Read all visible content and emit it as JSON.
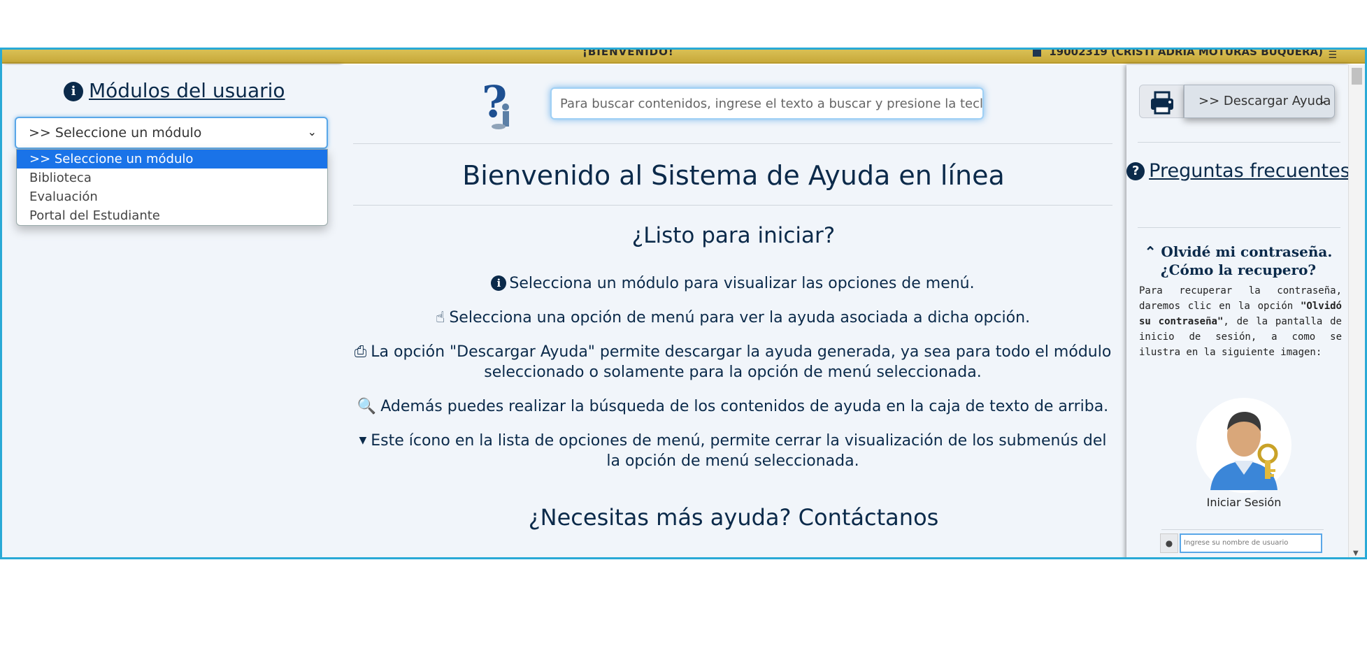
{
  "header": {
    "welcome": "¡BIENVENIDO!",
    "user": "19002319 (CRISTI ADRIA MOTURAS BUQUERA)"
  },
  "left": {
    "heading": "Módulos del usuario",
    "select_value": ">> Seleccione un módulo",
    "options": [
      ">> Seleccione un módulo",
      "Biblioteca",
      "Evaluación",
      "Portal del Estudiante"
    ]
  },
  "center": {
    "search_placeholder": "Para buscar contenidos, ingrese el texto a buscar y presione la tecla E",
    "title": "Bienvenido al Sistema de Ayuda en línea",
    "subtitle": "¿Listo para iniciar?",
    "lines": [
      "Selecciona un módulo para visualizar las opciones de menú.",
      "Selecciona una opción de menú para ver la ayuda asociada a dicha opción.",
      "La opción \"Descargar Ayuda\" permite descargar la ayuda generada, ya sea para todo el módulo seleccionado o solamente para la opción de menú seleccionada.",
      "Además puedes realizar la búsqueda de los contenidos de ayuda en la caja de texto de arriba.",
      "Este ícono en la lista de opciones de menú, permite cerrar la visualización de los submenús del la opción de menú seleccionada."
    ],
    "contact": "¿Necesitas más ayuda? Contáctanos"
  },
  "right": {
    "download_value": ">> Descargar Ayuda",
    "faq_title": "Preguntas frecuentes",
    "faq_question": "Olvidé mi contraseña. ¿Cómo la recupero?",
    "faq_answer_1": "Para recuperar la contraseña, daremos clic en la opción ",
    "faq_answer_bold": "\"Olvidó su contraseña\"",
    "faq_answer_2": ", de la pantalla de inicio de sesión, a como se ilustra en la siguiente imagen:",
    "login_label": "Iniciar Sesión",
    "login_placeholder": "Ingrese su nombre de usuario"
  },
  "colors": {
    "topbar": "#c8a93a",
    "frame_border": "#29a9d6",
    "text_dark": "#0b2a4a",
    "selected_option": "#1a73e8"
  },
  "icons": [
    "info-icon",
    "question-help-icon",
    "hand-pointer-icon",
    "print-icon",
    "search-icon",
    "caret-down-icon",
    "question-circle-icon",
    "chevron-double-up-icon",
    "user-icon"
  ]
}
